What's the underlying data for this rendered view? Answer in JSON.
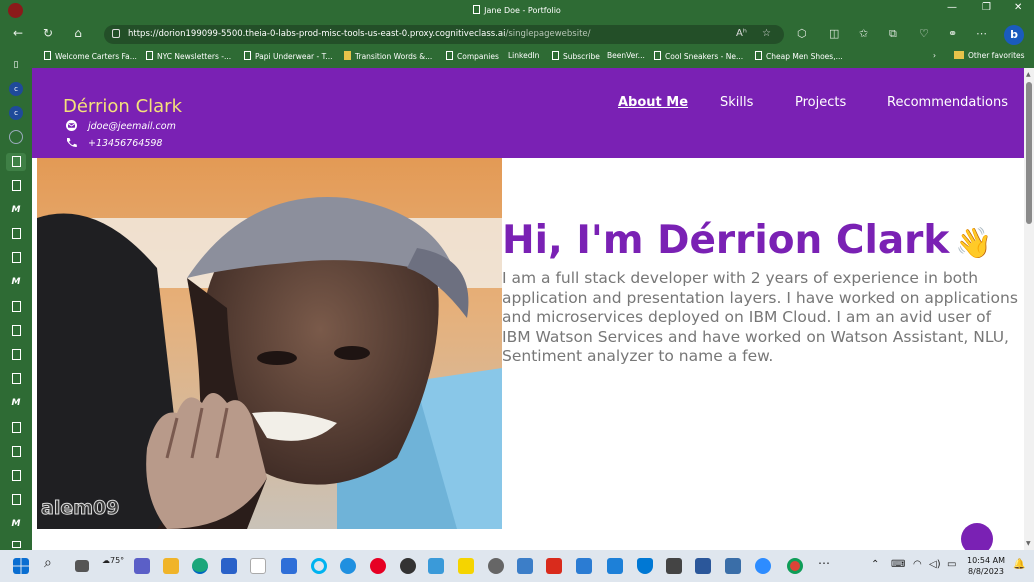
{
  "browser": {
    "window_title": "Jane Doe - Portfolio",
    "url_main": "https://dorion199099-5500.theia-0-labs-prod-misc-tools-us-east-0.proxy.cognitiveclass.ai",
    "url_path": "/singlepagewebsite/",
    "bookmarks": [
      "Welcome Carters Fa...",
      "NYC Newsletters -...",
      "Papi Underwear - T...",
      "Transition Words &...",
      "Companies",
      "LinkedIn",
      "Subscribe",
      "BeenVer...",
      "Cool Sneakers - Ne...",
      "Cheap Men Shoes,..."
    ],
    "other_favorites": "Other favorites"
  },
  "site": {
    "name": "Dérrion Clark",
    "email": "jdoe@jeemail.com",
    "phone": "+13456764598",
    "nav": [
      "About Me",
      "Skills",
      "Projects",
      "Recommendations"
    ],
    "photo_watermark": "alem09",
    "hero_title": "Hi, I'm Dérrion Clark",
    "hero_emoji": "👋",
    "hero_text": "I am a full stack developer with 2 years of experience in both application and presentation layers. I have worked on applications and microservices deployed on IBM Cloud. I am an avid user of IBM Watson Services and have worked on Watson Assistant, NLU, Sentiment analyzer to name a few."
  },
  "taskbar": {
    "temperature": "75°",
    "time": "10:54 AM",
    "date": "8/8/2023"
  },
  "colors": {
    "header_purple": "#7a21b4",
    "name_yellow": "#f5e27a",
    "browser_green": "#2e6b34"
  }
}
